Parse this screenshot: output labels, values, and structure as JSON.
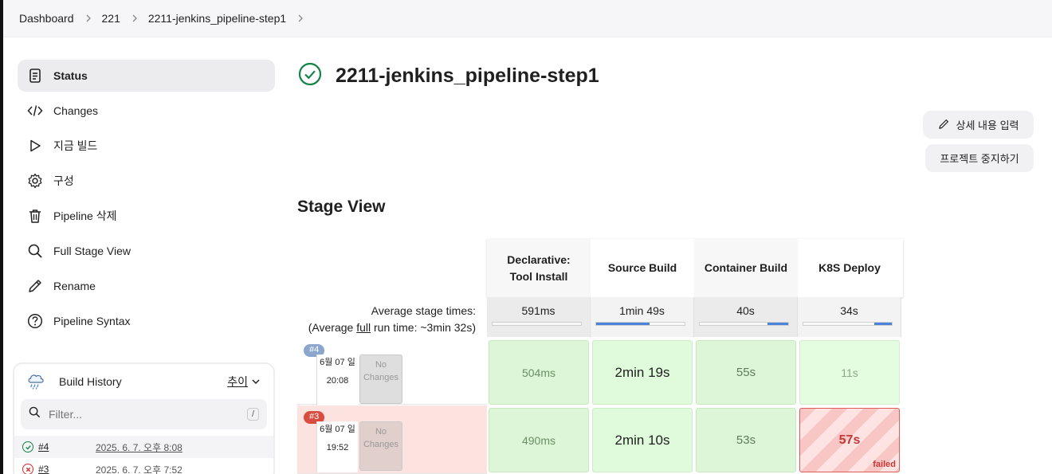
{
  "breadcrumb": [
    "Dashboard",
    "221",
    "2211-jenkins_pipeline-step1"
  ],
  "sidebar": {
    "items": [
      {
        "label": "Status",
        "icon": "document-icon"
      },
      {
        "label": "Changes",
        "icon": "code-icon"
      },
      {
        "label": "지금 빌드",
        "icon": "play-icon"
      },
      {
        "label": "구성",
        "icon": "gear-icon"
      },
      {
        "label": "Pipeline 삭제",
        "icon": "trash-icon"
      },
      {
        "label": "Full Stage View",
        "icon": "search-icon"
      },
      {
        "label": "Rename",
        "icon": "pencil-icon"
      },
      {
        "label": "Pipeline Syntax",
        "icon": "help-icon"
      }
    ]
  },
  "build_history": {
    "title": "Build History",
    "trend": "추이",
    "filter_placeholder": "Filter...",
    "shortcut": "/",
    "builds": [
      {
        "number": "#4",
        "date": "2025. 6. 7. 오후 8:08",
        "status": "success"
      },
      {
        "number": "#3",
        "date": "2025. 6. 7. 오후 7:52",
        "status": "failed"
      }
    ]
  },
  "page": {
    "title": "2211-jenkins_pipeline-step1",
    "edit_description": "상세 내용 입력",
    "disable_project": "프로젝트 중지하기",
    "stage_view_title": "Stage View"
  },
  "stage_view": {
    "stages": [
      "Declarative: Tool Install",
      "Source Build",
      "Container Build",
      "K8S Deploy"
    ],
    "avg_label_line1": "Average stage times:",
    "avg_label_pre": "(Average ",
    "avg_label_full": "full",
    "avg_label_post": " run time: ~3min 32s)",
    "averages": [
      "591ms",
      "1min 49s",
      "40s",
      "34s"
    ],
    "avg_fill_fractions": [
      0.0,
      0.6,
      0.23,
      0.2
    ],
    "runs": [
      {
        "badge": "#4",
        "date": "6월 07 일",
        "time": "20:08",
        "changes": "No Changes",
        "durations": [
          "504ms",
          "2min 19s",
          "55s",
          "11s"
        ],
        "stage_status": [
          "success",
          "success",
          "success",
          "success"
        ]
      },
      {
        "badge": "#3",
        "date": "6월 07 일",
        "time": "19:52",
        "changes": "No Changes",
        "durations": [
          "490ms",
          "2min 10s",
          "53s",
          "57s"
        ],
        "stage_status": [
          "success",
          "success",
          "success",
          "failed"
        ],
        "failed_label": "failed"
      }
    ]
  },
  "colors": {
    "success": "#138347",
    "failed": "#d62b2b",
    "progress": "#4a83d9"
  }
}
